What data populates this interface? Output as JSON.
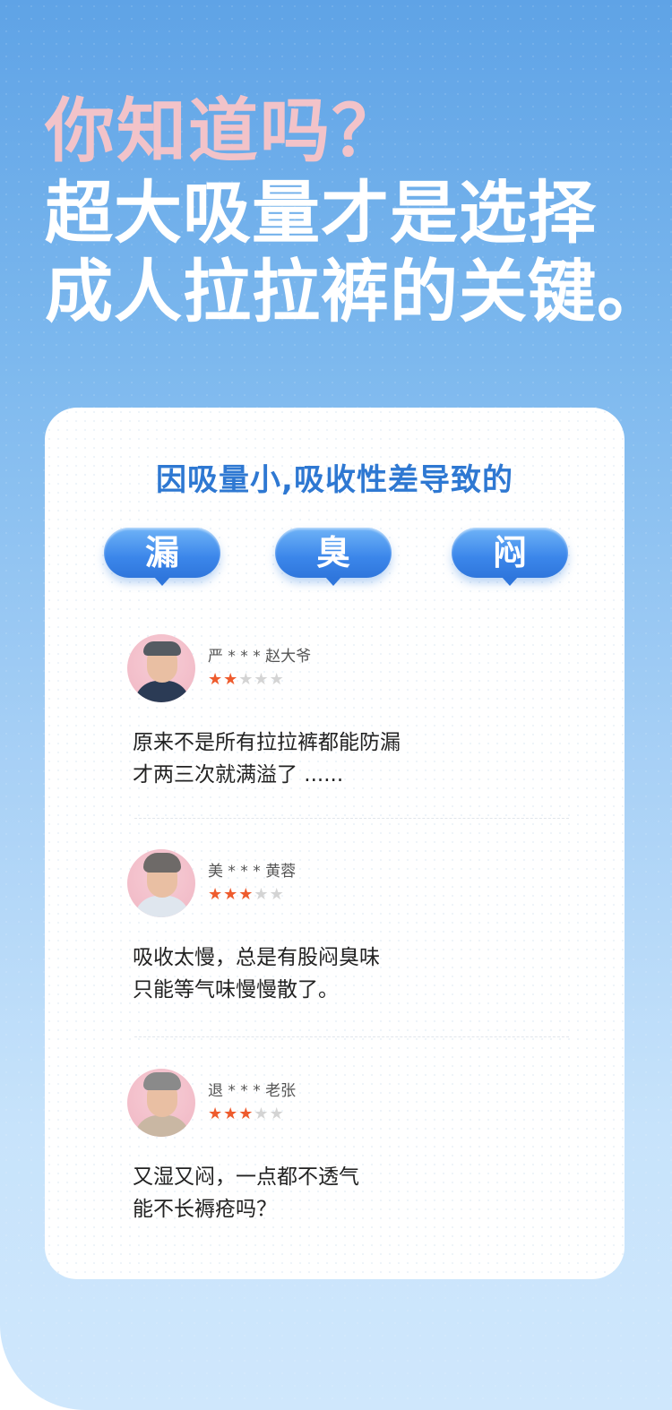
{
  "headline": {
    "line1": "你知道吗？",
    "line2": "超大吸量才是选择",
    "line3": "成人拉拉裤的关键。"
  },
  "card": {
    "title": "因吸量小,吸收性差导致的",
    "bubbles": [
      "漏",
      "臭",
      "闷"
    ]
  },
  "reviews": [
    {
      "name": "严 * * * 赵大爷",
      "rating": 2,
      "max_rating": 5,
      "text_line1": "原来不是所有拉拉裤都能防漏",
      "text_line2": "才两三次就满溢了 ......"
    },
    {
      "name": "美 * * * 黄蓉",
      "rating": 3,
      "max_rating": 5,
      "text_line1": "吸收太慢，总是有股闷臭味",
      "text_line2": "只能等气味慢慢散了。"
    },
    {
      "name": "退 * * * 老张",
      "rating": 3,
      "max_rating": 5,
      "text_line1": "又湿又闷，一点都不透气",
      "text_line2": "能不长褥疮吗？"
    }
  ],
  "colors": {
    "headline_pink": "#f2c3c9",
    "headline_white": "#ffffff",
    "title_blue": "#2e78d2",
    "bubble_blue": "#3b86ea",
    "star_on": "#ee5b2d",
    "star_off": "#d4d4d4"
  },
  "icons": {
    "rating": "star-icon",
    "avatar": "elderly-person-avatar"
  }
}
